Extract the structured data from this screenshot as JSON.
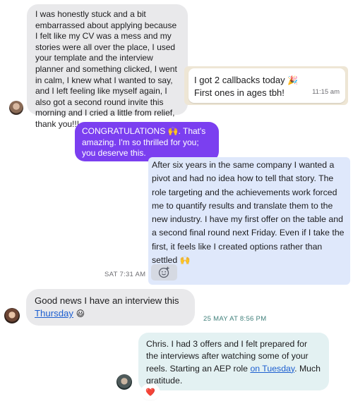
{
  "messages": {
    "m1": {
      "text": "I was honestly stuck and a bit embarrassed about applying because I felt like my CV was a mess and my stories were all over the place, I used your template and the interview planner and something clicked, I went in calm, I knew what I wanted to say, and I left feeling like myself again, I also got a second round invite this morning and I cried a little from relief, thank you!!!"
    },
    "m2": {
      "line1": "I got 2 callbacks today",
      "emoji": "🎉",
      "line2": "First ones in ages tbh!",
      "time": "11:15 am"
    },
    "m3": {
      "text_before": "CONGRATULATIONS",
      "emoji": "🙌",
      "text_after": ". That's amazing. I'm so thrilled for you; you deserve this."
    },
    "m4": {
      "text": "After six years in the same company I wanted a pivot and had no idea how to tell that story. The role targeting and the achievements work forced me to quantify results and translate them to the new industry. I have my first offer on the table and a second final round next Friday. Even if I take the first, it feels like I created options rather than settled",
      "emoji": "🙌"
    },
    "stamp1": "SAT 7:31 AM",
    "m5": {
      "text": "Good news I have an interview this",
      "link": "Thursday",
      "emoji": "😃"
    },
    "stamp2": "25 MAY AT 8:56 PM",
    "m6": {
      "text_before": "Chris. I had 3 offers and I felt prepared for the interviews after watching some of your reels. Starting an AEP role",
      "link": "on Tuesday",
      "text_after": ". Much gratitude."
    },
    "reaction": "❤️",
    "colors": {
      "purple": "#7b3ff0",
      "blue_bubble": "#dfe8fb",
      "gray_bubble": "#e9e9eb",
      "teal_bubble": "#e3f1f2",
      "whatsapp_bg": "#eee6d5",
      "link": "#1d5fd0"
    },
    "icons": {
      "add_reaction": "add-reaction-icon"
    }
  }
}
